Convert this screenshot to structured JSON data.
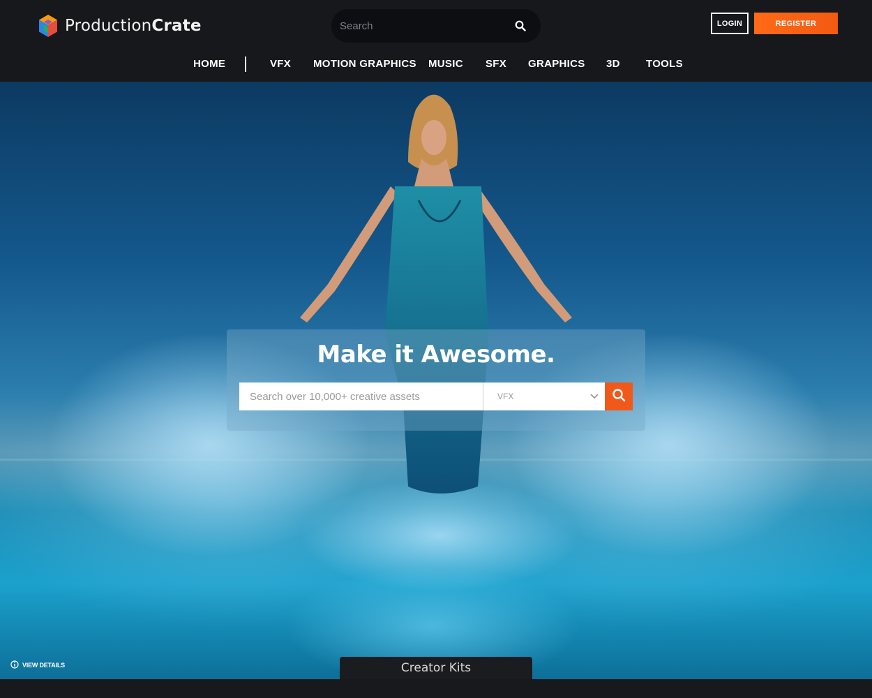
{
  "brand": {
    "name_light": "Production",
    "name_bold": "Crate"
  },
  "header": {
    "search_placeholder": "Search",
    "login_label": "LOGIN",
    "register_label": "REGISTER"
  },
  "nav": {
    "items": [
      {
        "label": "HOME"
      },
      {
        "label": "VFX"
      },
      {
        "label": "MOTION GRAPHICS"
      },
      {
        "label": "MUSIC"
      },
      {
        "label": "SFX"
      },
      {
        "label": "GRAPHICS"
      },
      {
        "label": "3D"
      },
      {
        "label": "TOOLS"
      }
    ]
  },
  "hero": {
    "title": "Make it Awesome.",
    "search_placeholder": "Search over 10,000+ creative assets",
    "category_selected": "VFX",
    "view_details_label": "VIEW DETAILS",
    "creator_kits_label": "Creator Kits"
  },
  "colors": {
    "accent": "#f0591a",
    "header_bg": "#17181c"
  },
  "icons": {
    "logo": "productioncrate-cube-icon",
    "search": "search-icon",
    "dropdown": "chevron-down-icon",
    "info": "info-icon"
  }
}
